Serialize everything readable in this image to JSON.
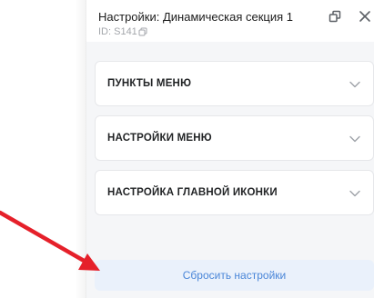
{
  "panel": {
    "title": "Настройки: Динамическая секция 1",
    "id_label": "ID: S141",
    "icons": {
      "copy": "copy-icon",
      "undock": "undock-icon",
      "close": "close-icon"
    }
  },
  "sections": [
    {
      "label": "ПУНКТЫ МЕНЮ",
      "icon": "chevron-down-icon",
      "expanded": false
    },
    {
      "label": "НАСТРОЙКИ МЕНЮ",
      "icon": "chevron-down-icon",
      "expanded": false
    },
    {
      "label": "НАСТРОЙКА ГЛАВНОЙ ИКОНКИ",
      "icon": "chevron-down-icon",
      "expanded": false
    }
  ],
  "reset_button": {
    "label": "Сбросить настройки"
  },
  "annotation": {
    "arrow_color": "#e5202a",
    "type": "red-arrow"
  },
  "colors": {
    "accent": "#4a86d8",
    "reset_bg": "#eaf1fb",
    "panel_bg": "#f5f6f8"
  }
}
